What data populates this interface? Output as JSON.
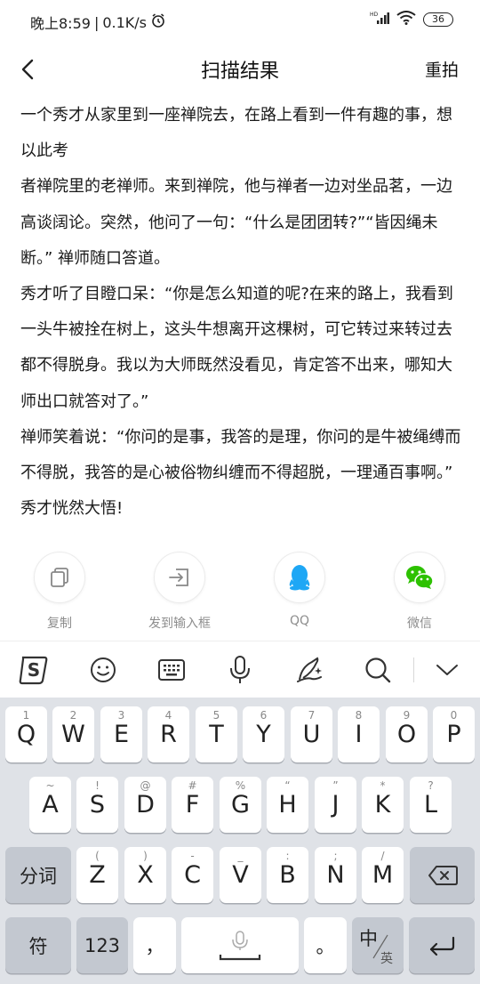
{
  "status_bar": {
    "time": "晚上8:59",
    "separator": "|",
    "network_speed": "0.1K/s",
    "battery": "36"
  },
  "header": {
    "title": "扫描结果",
    "reshoot_label": "重拍"
  },
  "result_paragraphs": [
    "一个秀才从家里到一座禅院去，在路上看到一件有趣的事，想以此考",
    "者禅院里的老禅师。来到禅院，他与禅者一边对坐品茗，一边高谈阔论。突然，他问了一句：“什么是团团转?”“皆因绳未断。” 禅师随口答道。",
    "秀才听了目瞪口呆：“你是怎么知道的呢?在来的路上，我看到一头牛被拴在树上，这头牛想离开这棵树，可它转过来转过去都不得脱身。我以为大师既然没看见，肯定答不出来，哪知大师出口就答对了。”",
    "禅师笑着说：“你问的是事，我答的是理，你问的是牛被绳缚而不得脱，我答的是心被俗物纠缠而不得超脱，一理通百事啊。” 秀才恍然大悟!"
  ],
  "share_actions": [
    {
      "label": "复制",
      "icon": "copy-icon"
    },
    {
      "label": "发到输入框",
      "icon": "send-to-input-icon"
    },
    {
      "label": "QQ",
      "icon": "qq-icon"
    },
    {
      "label": "微信",
      "icon": "wechat-icon"
    }
  ],
  "ime_toolbar": {
    "icons": [
      "sogou-logo-icon",
      "emoji-icon",
      "keyboard-icon",
      "microphone-icon",
      "handwriting-icon",
      "search-icon",
      "collapse-keyboard-icon"
    ]
  },
  "keyboard": {
    "row1": [
      {
        "main": "Q",
        "hint": "1"
      },
      {
        "main": "W",
        "hint": "2"
      },
      {
        "main": "E",
        "hint": "3"
      },
      {
        "main": "R",
        "hint": "4"
      },
      {
        "main": "T",
        "hint": "5"
      },
      {
        "main": "Y",
        "hint": "6"
      },
      {
        "main": "U",
        "hint": "7"
      },
      {
        "main": "I",
        "hint": "8"
      },
      {
        "main": "O",
        "hint": "9"
      },
      {
        "main": "P",
        "hint": "0"
      }
    ],
    "row2": [
      {
        "main": "A",
        "hint": "~"
      },
      {
        "main": "S",
        "hint": "!"
      },
      {
        "main": "D",
        "hint": "@"
      },
      {
        "main": "F",
        "hint": "#"
      },
      {
        "main": "G",
        "hint": "%"
      },
      {
        "main": "H",
        "hint": "“"
      },
      {
        "main": "J",
        "hint": "”"
      },
      {
        "main": "K",
        "hint": "*"
      },
      {
        "main": "L",
        "hint": "?"
      }
    ],
    "row3": [
      {
        "main": "Z",
        "hint": "("
      },
      {
        "main": "X",
        "hint": ")"
      },
      {
        "main": "C",
        "hint": "-"
      },
      {
        "main": "V",
        "hint": "_"
      },
      {
        "main": "B",
        "hint": ":"
      },
      {
        "main": "N",
        "hint": ";"
      },
      {
        "main": "M",
        "hint": "/"
      }
    ],
    "fenci_label": "分词",
    "symbol_label": "符",
    "num_label": "123",
    "comma_label": "，",
    "period_label": "。",
    "lang_main": "中",
    "lang_sub": "英"
  }
}
